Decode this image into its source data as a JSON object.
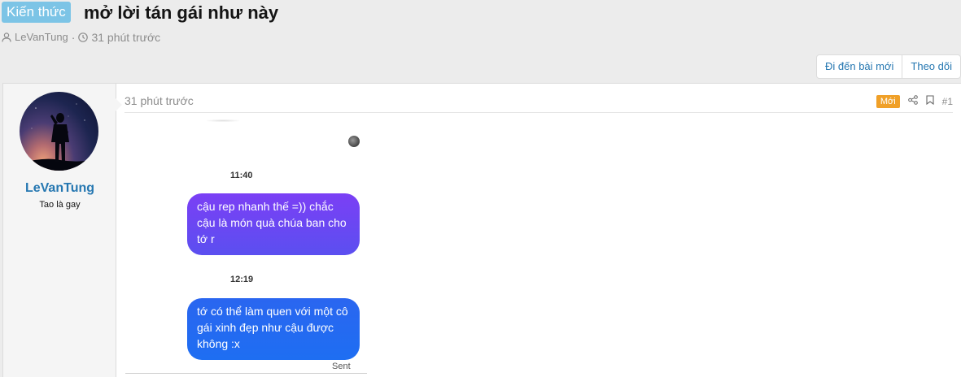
{
  "thread": {
    "prefix": "Kiến thức",
    "title": "mở lời tán gái như này",
    "author": "LeVanTung",
    "separator": "·",
    "time": "31 phút trước"
  },
  "actions": {
    "go_to_new": "Đi đến bài mới",
    "follow": "Theo dõi"
  },
  "post": {
    "username": "LeVanTung",
    "user_title": "Tao là gay",
    "time": "31 phút trước",
    "new_badge": "Mới",
    "number": "#1",
    "chat": {
      "messages": [
        {
          "time": "11:40",
          "text": "cậu rep nhanh thế =)) chắc cậu là món quà chúa ban cho tớ r"
        },
        {
          "time": "12:19",
          "text": "tớ có thể làm quen với một cô gái xinh đẹp như cậu được không :x"
        }
      ],
      "status": "Sent"
    }
  },
  "colors": {
    "prefix_bg": "#7cc4e6",
    "link": "#2577b1",
    "new_badge": "#f0a028",
    "bubble_purple": "#6a44f3",
    "bubble_blue": "#2468f1"
  },
  "icons": [
    "user-icon",
    "clock-icon",
    "share-icon",
    "bookmark-icon"
  ]
}
